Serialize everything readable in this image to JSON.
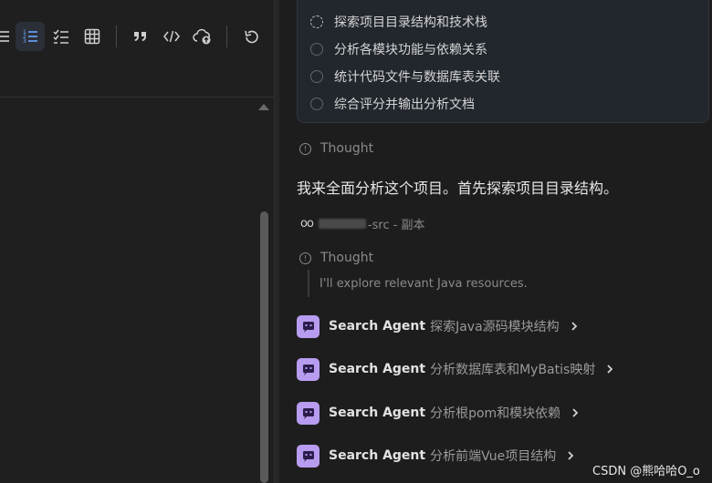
{
  "toolbar": {
    "buttons": [
      {
        "icon": "list-icon"
      },
      {
        "icon": "numbered-list-icon",
        "active": true
      },
      {
        "icon": "checklist-icon"
      },
      {
        "icon": "table-icon"
      },
      {
        "icon": "quote-icon"
      },
      {
        "icon": "code-icon"
      },
      {
        "icon": "cloud-upload-icon"
      },
      {
        "icon": "undo-icon"
      }
    ]
  },
  "todo": {
    "items": [
      {
        "label": "探索项目目录结构和技术栈",
        "status": "in-progress"
      },
      {
        "label": "分析各模块功能与依赖关系",
        "status": "pending"
      },
      {
        "label": "统计代码文件与数据库表关联",
        "status": "pending"
      },
      {
        "label": "综合评分并输出分析文档",
        "status": "pending"
      }
    ]
  },
  "thought1": {
    "label": "Thought"
  },
  "message": {
    "text": "我来全面分析这个项目。首先探索项目目录结构。"
  },
  "file_ref": {
    "suffix": "-src - 副本"
  },
  "thought2": {
    "label": "Thought",
    "detail": "I'll explore relevant Java resources."
  },
  "agents": [
    {
      "name": "Search Agent",
      "task": "探索Java源码模块结构"
    },
    {
      "name": "Search Agent",
      "task": "分析数据库表和MyBatis映射"
    },
    {
      "name": "Search Agent",
      "task": "分析根pom和模块依赖"
    },
    {
      "name": "Search Agent",
      "task": "分析前端Vue项目结构"
    }
  ],
  "watermark": {
    "text": "CSDN @熊哈哈O_o"
  },
  "colors": {
    "accent": "#6aa7ff",
    "agent_icon_bg": "#b79cf0",
    "background": "#1e1e1e"
  }
}
